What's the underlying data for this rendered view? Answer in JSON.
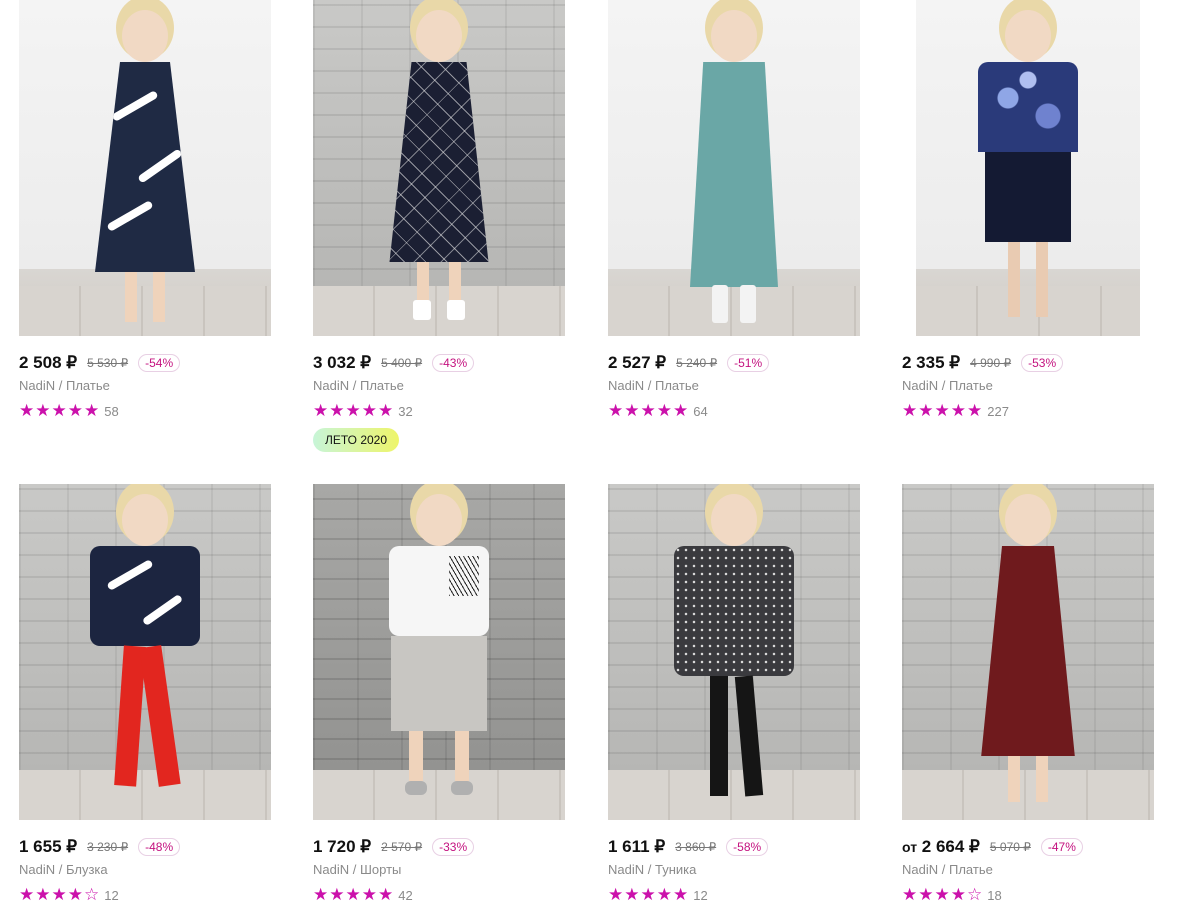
{
  "products": [
    {
      "price": "2 508 ₽",
      "old_price": "5 530 ₽",
      "discount": "-54%",
      "brand": "NadiN",
      "category": "Платье",
      "stars": 5,
      "reviews": "58",
      "colors": {
        "dress": "#1f2a44",
        "accent": "#ffffff"
      }
    },
    {
      "price": "3 032 ₽",
      "old_price": "5 400 ₽",
      "discount": "-43%",
      "brand": "NadiN",
      "category": "Платье",
      "stars": 5,
      "reviews": "32",
      "badge": "ЛЕТО 2020",
      "colors": {
        "dress": "#1b1f33",
        "accent": "#e6e6e6"
      }
    },
    {
      "price": "2 527 ₽",
      "old_price": "5 240 ₽",
      "discount": "-51%",
      "brand": "NadiN",
      "category": "Платье",
      "stars": 5,
      "reviews": "64",
      "colors": {
        "dress": "#6aa7a6",
        "accent": "#86bcbb"
      }
    },
    {
      "price": "2 335 ₽",
      "old_price": "4 990 ₽",
      "discount": "-53%",
      "brand": "NadiN",
      "category": "Платье",
      "stars": 5,
      "reviews": "227",
      "colors": {
        "dress": "#1a2140",
        "accent": "#4b64b8"
      }
    },
    {
      "price": "1 655 ₽",
      "old_price": "3 230 ₽",
      "discount": "-48%",
      "brand": "NadiN",
      "category": "Блузка",
      "stars": 4,
      "reviews": "12",
      "colors": {
        "dress": "#1c2540",
        "accent": "#e2261f"
      }
    },
    {
      "price": "1 720 ₽",
      "old_price": "2 570 ₽",
      "discount": "-33%",
      "brand": "NadiN",
      "category": "Шорты",
      "stars": 5,
      "reviews": "42",
      "colors": {
        "dress": "#f6f6f6",
        "accent": "#c8c6c2"
      }
    },
    {
      "price": "1 611 ₽",
      "old_price": "3 860 ₽",
      "discount": "-58%",
      "brand": "NadiN",
      "category": "Туника",
      "stars": 5,
      "reviews": "12",
      "colors": {
        "dress": "#3a3a3e",
        "accent": "#151515"
      }
    },
    {
      "price": "2 664 ₽",
      "price_prefix": "от",
      "old_price": "5 070 ₽",
      "discount": "-47%",
      "brand": "NadiN",
      "category": "Платье",
      "stars": 4,
      "reviews": "18",
      "colors": {
        "dress": "#6f1a1d",
        "accent": "#7a1f22"
      }
    }
  ],
  "icons": {
    "star_full": "★",
    "star_empty": "☆",
    "separator": "/"
  }
}
